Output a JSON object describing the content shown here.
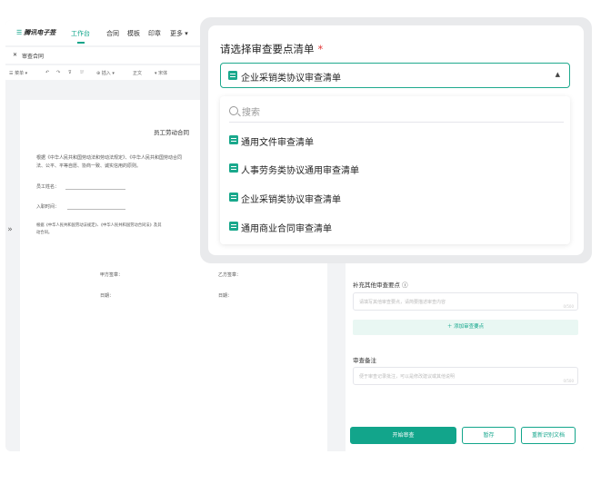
{
  "app": {
    "logo_mark": "☰",
    "logo_text": "腾讯电子签",
    "nav": [
      "工作台",
      "合同",
      "模板",
      "印章",
      "更多 ▾"
    ],
    "doc_tab": {
      "close": "✕",
      "title": "审查合同"
    },
    "toolbar": [
      "☰ 菜单 ▾",
      "↶",
      "↷",
      "⊽",
      "⛆",
      "⊕ 插入 ▾",
      "正文",
      "▾ 宋体"
    ]
  },
  "document": {
    "title": "员工劳动合同",
    "para1_line1": "根据《中华人民共和国劳动法和劳动法规定》、《中华人民共和国劳动合同",
    "para1_line2": "法、公平、平等自愿、协商一致、诚实信用的原则。",
    "name_label": "员工姓名：",
    "date_label": "入职时间：",
    "para2_line1": "根据《中华人民共和国劳动法规定》、《中华人民共和国劳动合同法》及其",
    "para2_line2": "动合同。",
    "party_a_sign": "甲方签章：",
    "party_b_sign": "乙方签章：",
    "date_a": "日期：",
    "date_b": "日期：",
    "collapse": "»"
  },
  "panel": {
    "extra_points_label": "补充其他审查要点 ⓘ",
    "extra_points_placeholder": "请填写其他审查要点，请简要描述审查内容",
    "counter": "0/500",
    "add_point": "＋ 添加审查要点",
    "notes_label": "审查备注",
    "notes_placeholder": "便于审查记录批注，可以是修改建议或其他说明",
    "counter2": "0/500",
    "btn_start": "开始审查",
    "btn_save": "暂存",
    "btn_reidentify": "重新识别文档"
  },
  "modal": {
    "title": "请选择审查要点清单",
    "required_mark": "*",
    "selected": "企业采销类协议审查清单",
    "arrow": "▲",
    "search_placeholder": "搜索",
    "options": [
      "通用文件审查清单",
      "人事劳务类协议通用审查清单",
      "企业采销类协议审查清单",
      "通用商业合同审查清单"
    ]
  },
  "colors": {
    "accent": "#12a58b",
    "required": "#e23c3c"
  }
}
